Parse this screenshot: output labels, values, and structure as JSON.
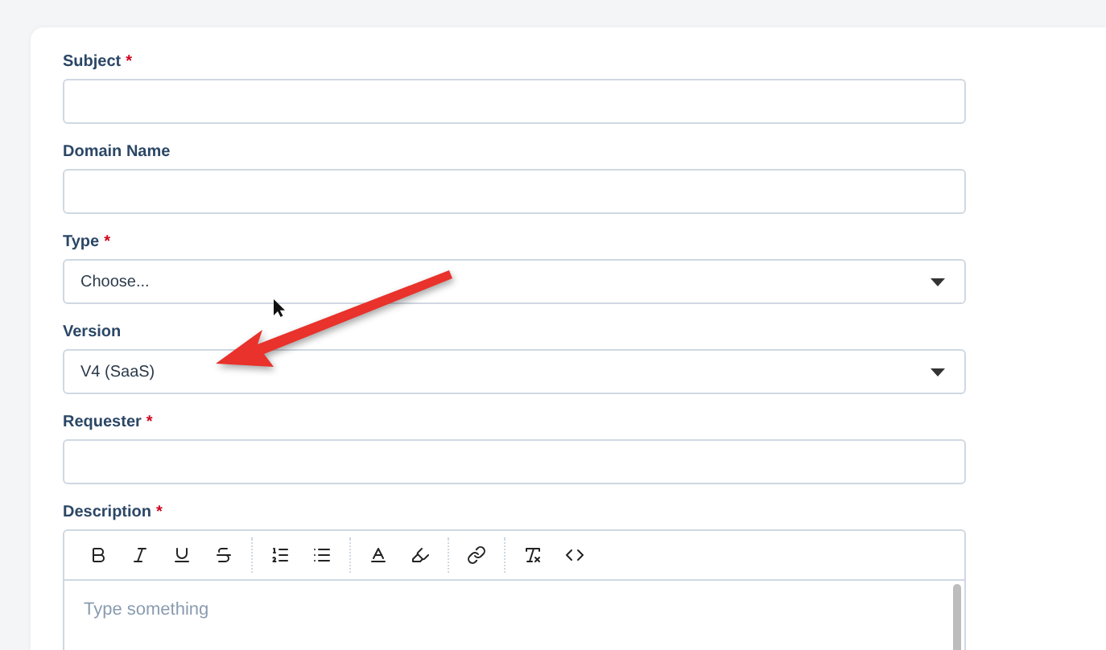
{
  "fields": [
    {
      "label": "Subject",
      "required_mark": "*",
      "kind": "text"
    },
    {
      "label": "Domain Name",
      "kind": "text"
    },
    {
      "label": "Type",
      "required_mark": "*",
      "kind": "select",
      "value": "Choose..."
    },
    {
      "label": "Version",
      "kind": "select",
      "value": "V4 (SaaS)"
    },
    {
      "label": "Requester",
      "required_mark": "*",
      "kind": "text"
    }
  ],
  "description": {
    "label": "Description",
    "required_mark": "*",
    "placeholder": "Type something",
    "toolbar": [
      [
        {
          "kind": "bold"
        },
        {
          "kind": "italic"
        },
        {
          "kind": "underline"
        },
        {
          "kind": "strikethrough"
        }
      ],
      [
        {
          "kind": "ordered-list"
        },
        {
          "kind": "bullet-list"
        }
      ],
      [
        {
          "kind": "text-color"
        },
        {
          "kind": "highlight"
        }
      ],
      [
        {
          "kind": "link"
        }
      ],
      [
        {
          "kind": "clear-format"
        },
        {
          "kind": "code"
        }
      ]
    ]
  }
}
